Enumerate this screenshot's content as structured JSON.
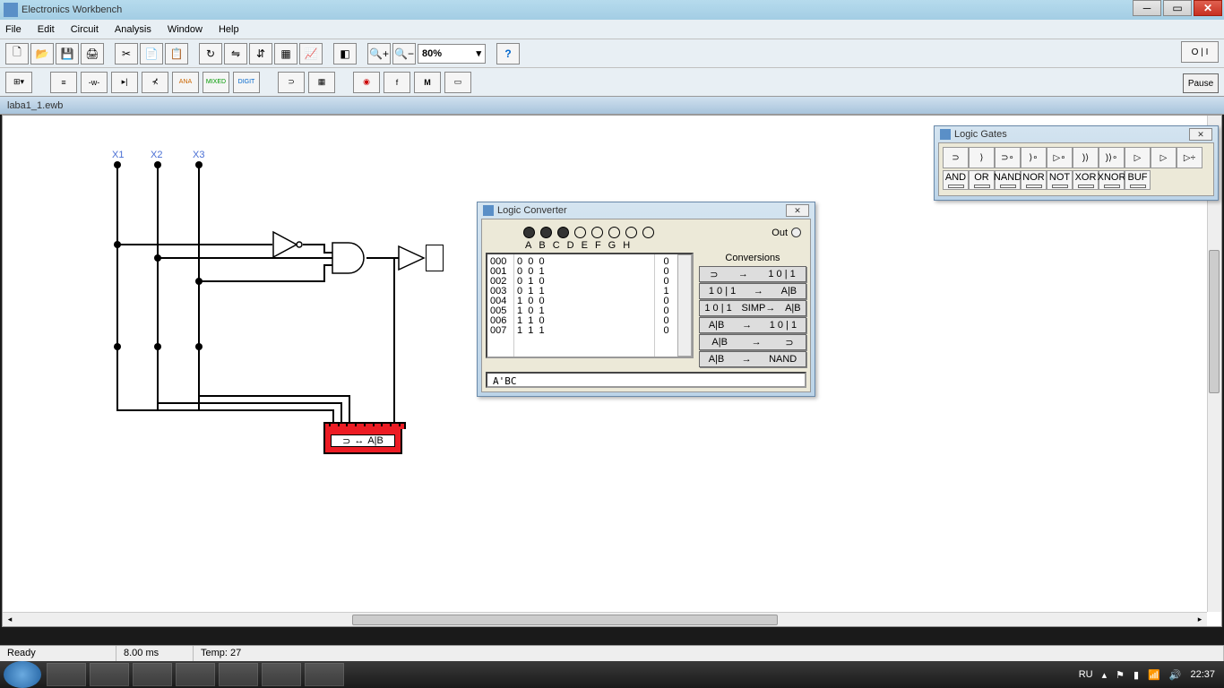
{
  "window": {
    "title": "Electronics Workbench",
    "doc": "laba1_1.ewb"
  },
  "menu": {
    "file": "File",
    "edit": "Edit",
    "circuit": "Circuit",
    "analysis": "Analysis",
    "window": "Window",
    "help": "Help"
  },
  "toolbar": {
    "zoom": "80%",
    "pause": "Pause"
  },
  "status": {
    "ready": "Ready",
    "time": "8.00 ms",
    "temp": "Temp: 27"
  },
  "inputs": {
    "x1": "X1",
    "x2": "X2",
    "x3": "X3"
  },
  "logic_module": {
    "label": "A|B"
  },
  "gates_panel": {
    "title": "Logic Gates",
    "labels": [
      "AND",
      "OR",
      "NAND",
      "NOR",
      "NOT",
      "XOR",
      "XNOR",
      "BUF"
    ]
  },
  "lc_panel": {
    "title": "Logic Converter",
    "out": "Out",
    "columns": [
      "A",
      "B",
      "C",
      "D",
      "E",
      "F",
      "G",
      "H"
    ],
    "rows": [
      {
        "i": "000",
        "a": "0",
        "b": "0",
        "c": "0",
        "o": "0"
      },
      {
        "i": "001",
        "a": "0",
        "b": "0",
        "c": "1",
        "o": "0"
      },
      {
        "i": "002",
        "a": "0",
        "b": "1",
        "c": "0",
        "o": "0"
      },
      {
        "i": "003",
        "a": "0",
        "b": "1",
        "c": "1",
        "o": "1"
      },
      {
        "i": "004",
        "a": "1",
        "b": "0",
        "c": "0",
        "o": "0"
      },
      {
        "i": "005",
        "a": "1",
        "b": "0",
        "c": "1",
        "o": "0"
      },
      {
        "i": "006",
        "a": "1",
        "b": "1",
        "c": "0",
        "o": "0"
      },
      {
        "i": "007",
        "a": "1",
        "b": "1",
        "c": "1",
        "o": "0"
      }
    ],
    "conversions": "Conversions",
    "conv_btns": [
      {
        "l": "⊃",
        "m": "→",
        "r": "1 0 | 1"
      },
      {
        "l": "1 0 | 1",
        "m": "→",
        "r": "A|B"
      },
      {
        "l": "1 0 | 1",
        "m": "SIMP→",
        "r": "A|B"
      },
      {
        "l": "A|B",
        "m": "→",
        "r": "1 0 | 1"
      },
      {
        "l": "A|B",
        "m": "→",
        "r": "⊃"
      },
      {
        "l": "A|B",
        "m": "→",
        "r": "NAND"
      }
    ],
    "expression": "A'BC"
  },
  "tray": {
    "lang": "RU",
    "time": "22:37"
  }
}
